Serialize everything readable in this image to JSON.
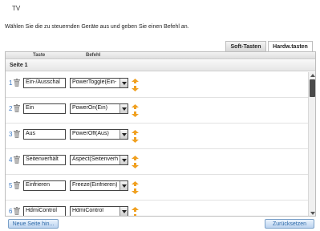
{
  "app_title": "TV",
  "instruction": "Wählen Sie die zu steuernden Geräte aus und geben Sie einen Befehl an.",
  "tabs": [
    {
      "label": "Soft-Tasten",
      "active": true
    },
    {
      "label": "Hardw.tasten",
      "active": false
    }
  ],
  "columns": {
    "key": "Taste",
    "command": "Befehl"
  },
  "page_label": "Seite 1",
  "rows": [
    {
      "num": "1",
      "key": "Ein-/Ausschal",
      "command": "PowerToggle(Ein-"
    },
    {
      "num": "2",
      "key": "Ein",
      "command": "PowerOn(Ein)"
    },
    {
      "num": "3",
      "key": "Aus",
      "command": "PowerOff(Aus)"
    },
    {
      "num": "4",
      "key": "Seitenverhält",
      "command": "Aspect(Seitenverh"
    },
    {
      "num": "5",
      "key": "Einfrieren",
      "command": "Freeze(Einfrieren)"
    },
    {
      "num": "6",
      "key": "HdmiControl",
      "command": "HdmiControl"
    }
  ],
  "buttons": {
    "new_page": "Neue Seite hin...",
    "reset": "Zurücksetzen"
  },
  "colors": {
    "accent": "#3a78c3",
    "arrow": "#f0a020",
    "button_text": "#2d6aa9"
  }
}
